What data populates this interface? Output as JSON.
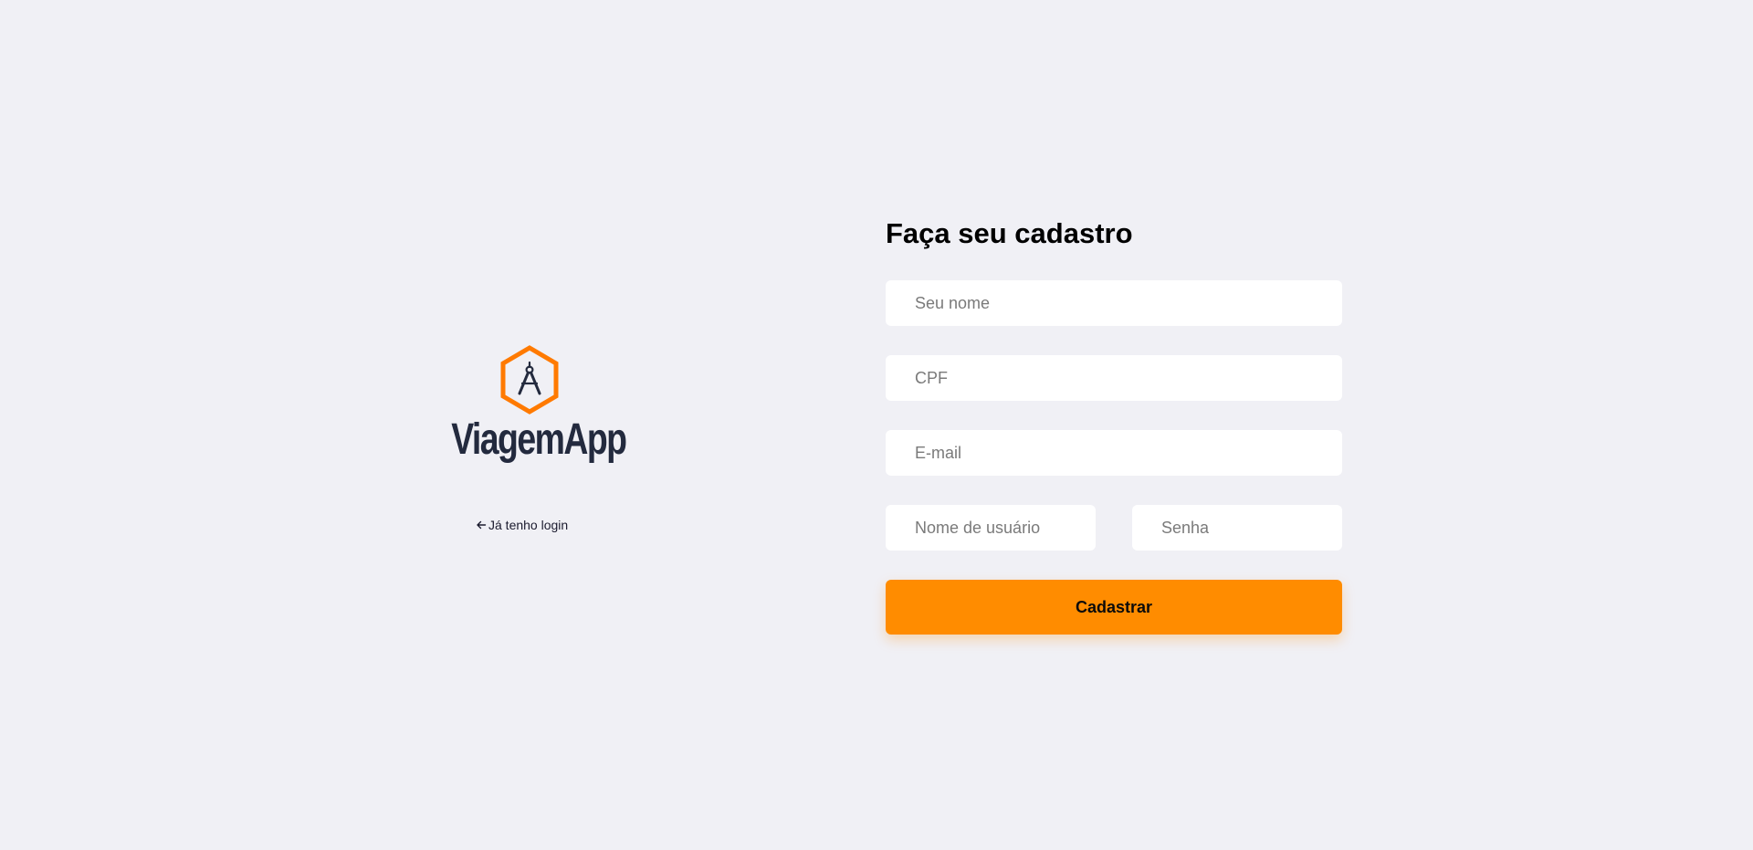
{
  "brand": {
    "name": "ViagemApp",
    "logo_icon": "compass-hexagon-icon",
    "accent_color": "#ff7a00",
    "text_color": "#232a3e"
  },
  "nav": {
    "back_icon": "arrow-left-icon",
    "back_label": "Já tenho login"
  },
  "form": {
    "title": "Faça seu cadastro",
    "fields": {
      "name": {
        "placeholder": "Seu nome",
        "value": ""
      },
      "cpf": {
        "placeholder": "CPF",
        "value": ""
      },
      "email": {
        "placeholder": "E-mail",
        "value": ""
      },
      "username": {
        "placeholder": "Nome de usuário",
        "value": ""
      },
      "password": {
        "placeholder": "Senha",
        "value": ""
      }
    },
    "submit_label": "Cadastrar",
    "submit_color": "#ff8c00"
  },
  "page": {
    "background_color": "#f0f0f5"
  }
}
